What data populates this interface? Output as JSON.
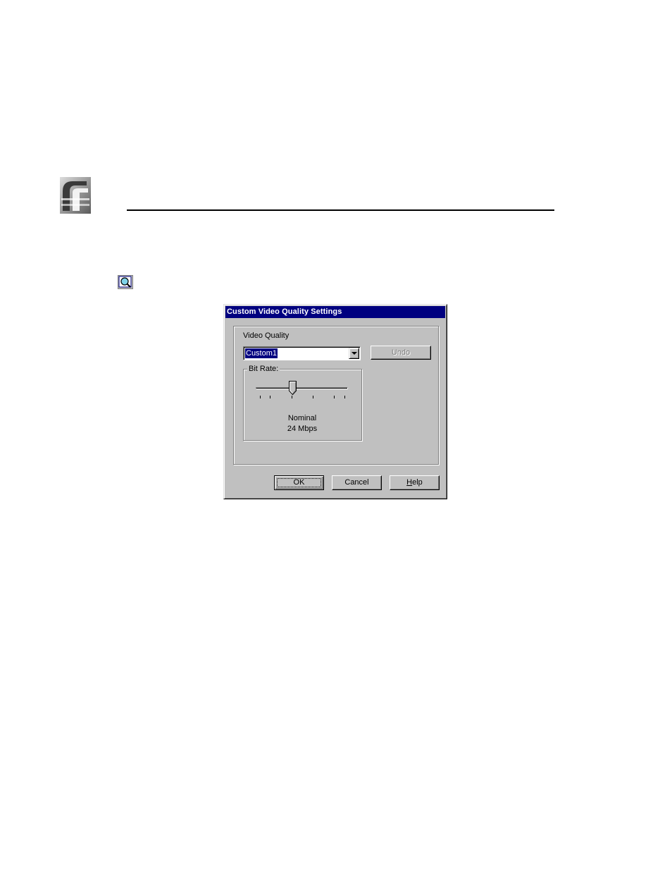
{
  "dialog": {
    "title": "Custom Video Quality Settings",
    "video_quality_label": "Video Quality",
    "selected_quality": "Custom1",
    "undo_label": "Undo",
    "bit_rate_label": "Bit Rate:",
    "slider": {
      "position_fraction": 0.39,
      "tick_count": 7
    },
    "nominal_label": "Nominal",
    "rate_value": "24 Mbps",
    "ok_label": "OK",
    "cancel_label": "Cancel",
    "help_label": "Help"
  },
  "colors": {
    "titlebar": "#000080",
    "face": "#c0c0c0",
    "selection": "#000080"
  },
  "icons": [
    "product-logo-icon",
    "magnifier-note-icon",
    "dropdown-arrow-icon",
    "slider-thumb-icon"
  ]
}
